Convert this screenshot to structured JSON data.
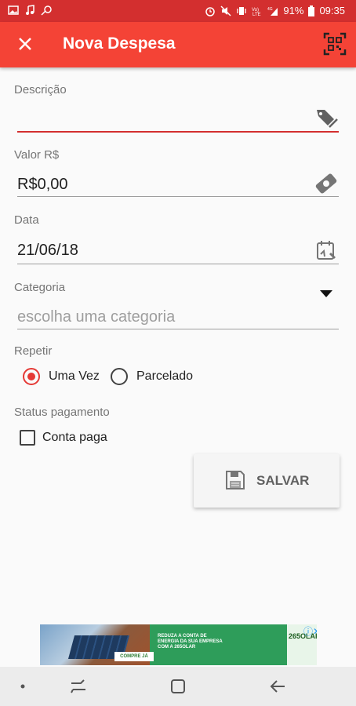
{
  "status_bar": {
    "battery": "91%",
    "time": "09:35"
  },
  "app_bar": {
    "title": "Nova Despesa"
  },
  "form": {
    "descricao": {
      "label": "Descrição",
      "value": ""
    },
    "valor": {
      "label": "Valor R$",
      "value": "R$0,00"
    },
    "data": {
      "label": "Data",
      "value": "21/06/18"
    },
    "categoria": {
      "label": "Categoria",
      "placeholder": "escolha uma categoria"
    },
    "repetir": {
      "label": "Repetir",
      "options": [
        {
          "label": "Uma Vez",
          "selected": true
        },
        {
          "label": "Parcelado",
          "selected": false
        }
      ]
    },
    "status": {
      "label": "Status pagamento",
      "checkbox_label": "Conta paga",
      "checked": false
    }
  },
  "save_button": {
    "label": "SALVAR"
  },
  "ad": {
    "button": "COMPRE JÁ",
    "headline": "REDUZA A CONTA DE ENERGIA DA SUA EMPRESA COM A 265OLAR",
    "brand": "265OLAR"
  },
  "colors": {
    "primary": "#f44336",
    "primary_dark": "#d32f2f",
    "accent": "#e53935"
  }
}
